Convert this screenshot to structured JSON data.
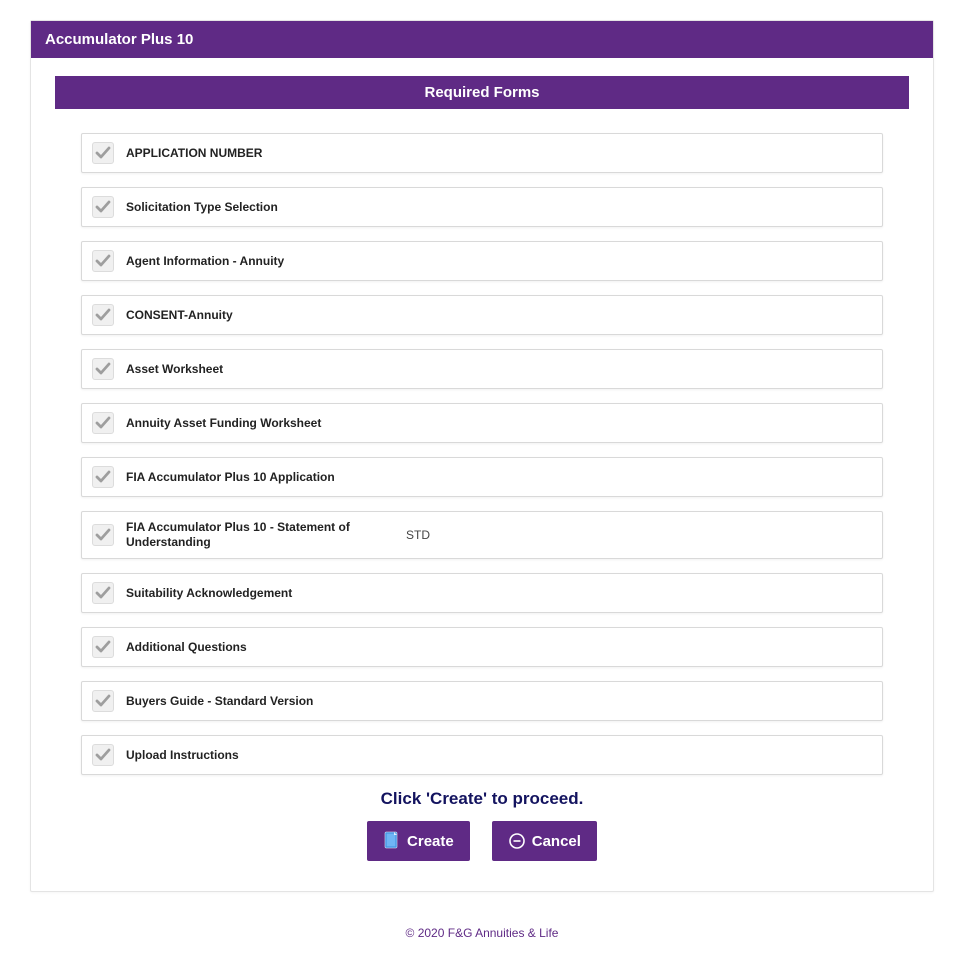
{
  "header": {
    "title": "Accumulator Plus 10"
  },
  "section": {
    "title": "Required Forms"
  },
  "forms": [
    {
      "label": "APPLICATION NUMBER",
      "suffix": ""
    },
    {
      "label": "Solicitation Type Selection",
      "suffix": ""
    },
    {
      "label": "Agent Information - Annuity",
      "suffix": ""
    },
    {
      "label": "CONSENT-Annuity",
      "suffix": ""
    },
    {
      "label": "Asset Worksheet",
      "suffix": ""
    },
    {
      "label": "Annuity Asset Funding Worksheet",
      "suffix": ""
    },
    {
      "label": "FIA Accumulator Plus 10 Application",
      "suffix": ""
    },
    {
      "label": "FIA Accumulator Plus 10 - Statement of Understanding",
      "suffix": "STD"
    },
    {
      "label": "Suitability Acknowledgement",
      "suffix": ""
    },
    {
      "label": "Additional Questions",
      "suffix": ""
    },
    {
      "label": "Buyers Guide - Standard Version",
      "suffix": ""
    },
    {
      "label": "Upload Instructions",
      "suffix": ""
    }
  ],
  "instruction": "Click 'Create' to proceed.",
  "buttons": {
    "create": "Create",
    "cancel": "Cancel"
  },
  "footer": "© 2020 F&G Annuities & Life",
  "colors": {
    "brand": "#5f2a85",
    "accent_text": "#13135f"
  }
}
